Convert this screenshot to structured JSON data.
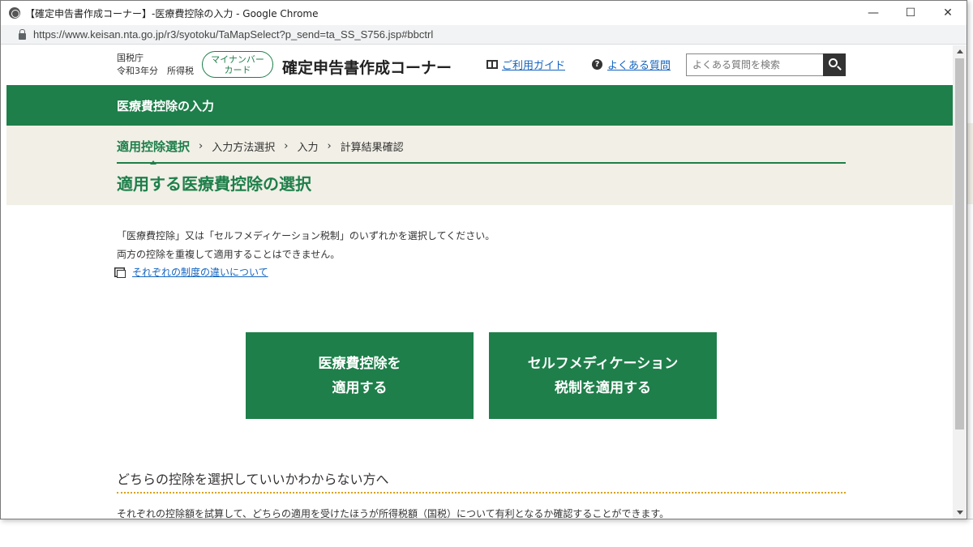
{
  "browser": {
    "window_title": "【確定申告書作成コーナー】-医療費控除の入力 - Google Chrome",
    "url": "https://www.keisan.nta.go.jp/r3/syotoku/TaMapSelect?p_send=ta_SS_S756.jsp#bbctrl",
    "minimize": "—",
    "maximize": "☐",
    "close": "✕"
  },
  "header": {
    "org_line1": "国税庁",
    "org_line2": "令和3年分　所得税",
    "mynumber_line1": "マイナンバー",
    "mynumber_line2": "カード",
    "site_title": "確定申告書作成コーナー",
    "guide_link": "ご利用ガイド",
    "faq_link": "よくある質問",
    "search_placeholder": "よくある質問を検索"
  },
  "page_title": "医療費控除の入力",
  "steps": [
    {
      "label": "適用控除選択",
      "active": true
    },
    {
      "label": "入力方法選択",
      "active": false
    },
    {
      "label": "入力",
      "active": false
    },
    {
      "label": "計算結果確認",
      "active": false
    }
  ],
  "section_title": "適用する医療費控除の選択",
  "description": {
    "line1": "「医療費控除」又は「セルフメディケーション税制」のいずれかを選択してください。",
    "line2": "両方の控除を重複して適用することはできません。",
    "diff_link": "それぞれの制度の違いについて"
  },
  "choices": {
    "medical_line1": "医療費控除を",
    "medical_line2": "適用する",
    "self_line1": "セルフメディケーション",
    "self_line2": "税制を適用する"
  },
  "help": {
    "heading": "どちらの控除を選択していいかわからない方へ",
    "body": "それぞれの控除額を試算して、どちらの適用を受けたほうが所得税額（国税）について有利となるか確認することができます。"
  },
  "colors": {
    "brand_green": "#1e7f4a",
    "band_beige": "#f1efe6",
    "link_blue": "#1565c0",
    "dotted_orange": "#d9a21a"
  }
}
